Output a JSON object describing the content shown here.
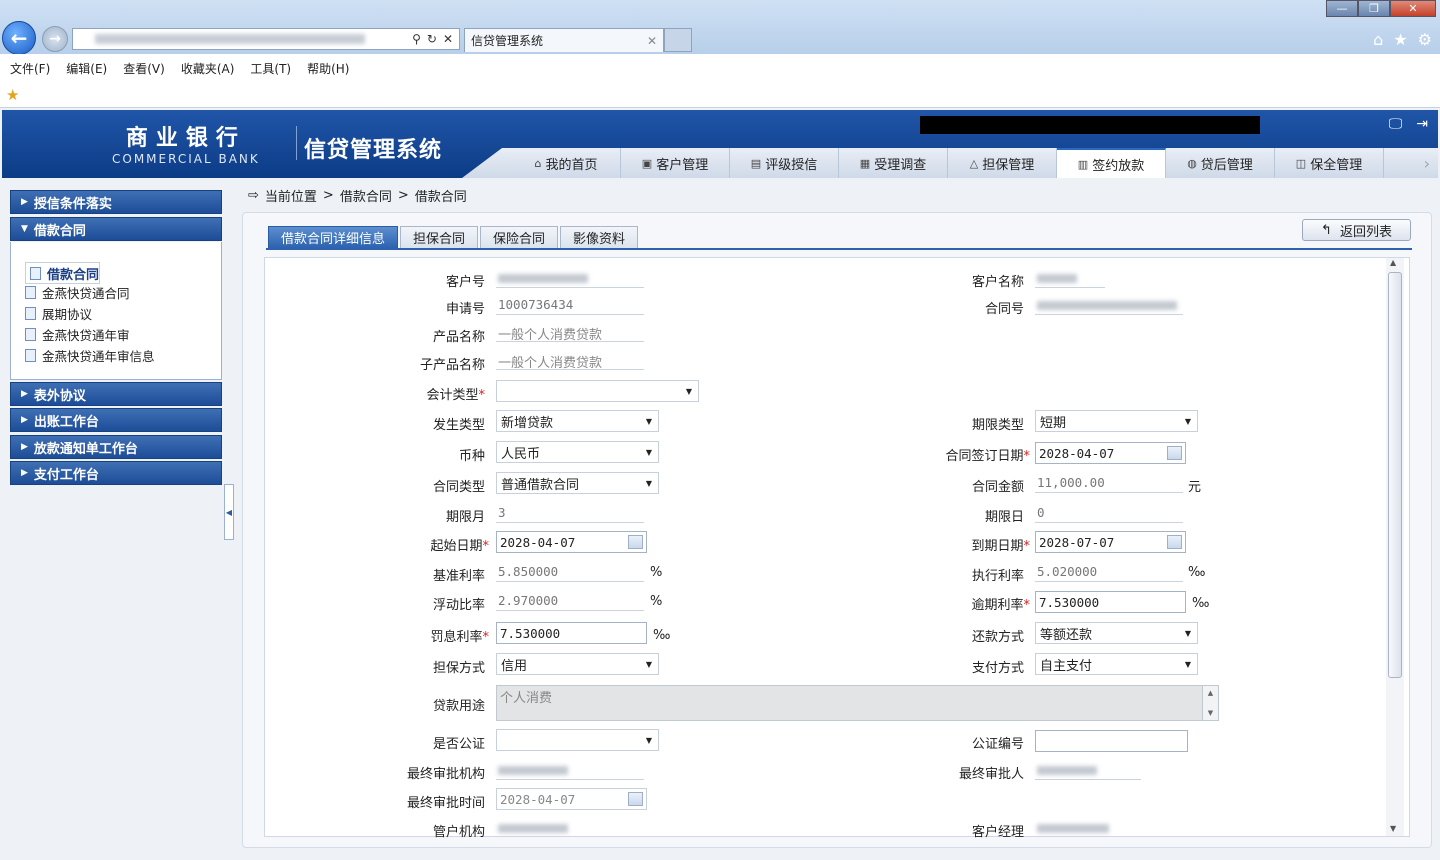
{
  "browser": {
    "tab_title": "信贷管理系统",
    "window_minimize": "—",
    "window_restore": "❐",
    "window_close": "✕",
    "menu": [
      "文件(F)",
      "编辑(E)",
      "查看(V)",
      "收藏夹(A)",
      "工具(T)",
      "帮助(H)"
    ]
  },
  "header": {
    "bank_cn": "商业银行",
    "bank_en": "COMMERCIAL BANK",
    "system_title": "信贷管理系统",
    "nav": [
      {
        "label": "我的首页",
        "icon": "home-icon"
      },
      {
        "label": "客户管理",
        "icon": "customer-icon"
      },
      {
        "label": "评级授信",
        "icon": "rating-icon"
      },
      {
        "label": "受理调查",
        "icon": "survey-icon"
      },
      {
        "label": "担保管理",
        "icon": "guarantee-icon"
      },
      {
        "label": "签约放款",
        "icon": "contract-icon",
        "active": true
      },
      {
        "label": "贷后管理",
        "icon": "postloan-icon"
      },
      {
        "label": "保全管理",
        "icon": "preservation-icon"
      }
    ]
  },
  "sidebar": {
    "sections": [
      "授信条件落实",
      "借款合同",
      "表外协议",
      "出账工作台",
      "放款通知单工作台",
      "支付工作台"
    ],
    "items": [
      "借款合同",
      "金燕快贷通合同",
      "展期协议",
      "金燕快贷通年审",
      "金燕快贷通年审信息"
    ]
  },
  "breadcrumb": {
    "label": "当前位置",
    "sep": ">",
    "path": [
      "借款合同",
      "借款合同"
    ]
  },
  "tabs": [
    "借款合同详细信息",
    "担保合同",
    "保险合同",
    "影像资料"
  ],
  "back_button": "返回列表",
  "form": {
    "customer_no_label": "客户号",
    "customer_name_label": "客户名称",
    "apply_no_label": "申请号",
    "apply_no": "1000736434",
    "contract_no_label": "合同号",
    "product_label": "产品名称",
    "product": "一般个人消费贷款",
    "sub_product_label": "子产品名称",
    "sub_product": "一般个人消费贷款",
    "account_type_label": "会计类型",
    "account_type": "",
    "occur_type_label": "发生类型",
    "occur_type": "新增贷款",
    "term_type_label": "期限类型",
    "term_type": "短期",
    "currency_label": "币种",
    "currency": "人民币",
    "sign_date_label": "合同签订日期",
    "sign_date": "2028-04-07",
    "contract_type_label": "合同类型",
    "contract_type": "普通借款合同",
    "amount_label": "合同金额",
    "amount": "11,000.00",
    "amount_unit": "元",
    "term_month_label": "期限月",
    "term_month": "3",
    "term_day_label": "期限日",
    "term_day": "0",
    "start_date_label": "起始日期",
    "start_date": "2028-04-07",
    "end_date_label": "到期日期",
    "end_date": "2028-07-07",
    "base_rate_label": "基准利率",
    "base_rate": "5.850000",
    "base_rate_unit": "%",
    "exec_rate_label": "执行利率",
    "exec_rate": "5.020000",
    "exec_rate_unit": "‰",
    "float_ratio_label": "浮动比率",
    "float_ratio": "2.970000",
    "float_ratio_unit": "%",
    "overdue_rate_label": "逾期利率",
    "overdue_rate": "7.530000",
    "overdue_rate_unit": "‰",
    "penalty_rate_label": "罚息利率",
    "penalty_rate": "7.530000",
    "penalty_rate_unit": "‰",
    "repay_label": "还款方式",
    "repay": "等额还款",
    "guarantee_label": "担保方式",
    "guarantee": "信用",
    "pay_label": "支付方式",
    "pay": "自主支付",
    "purpose_label": "贷款用途",
    "purpose": "个人消费",
    "notary_label": "是否公证",
    "notary": "",
    "notary_no_label": "公证编号",
    "notary_no": "",
    "final_org_label": "最终审批机构",
    "final_person_label": "最终审批人",
    "final_time_label": "最终审批时间",
    "final_time": "2028-04-07",
    "manage_org_label": "管户机构",
    "manager_label": "客户经理"
  }
}
